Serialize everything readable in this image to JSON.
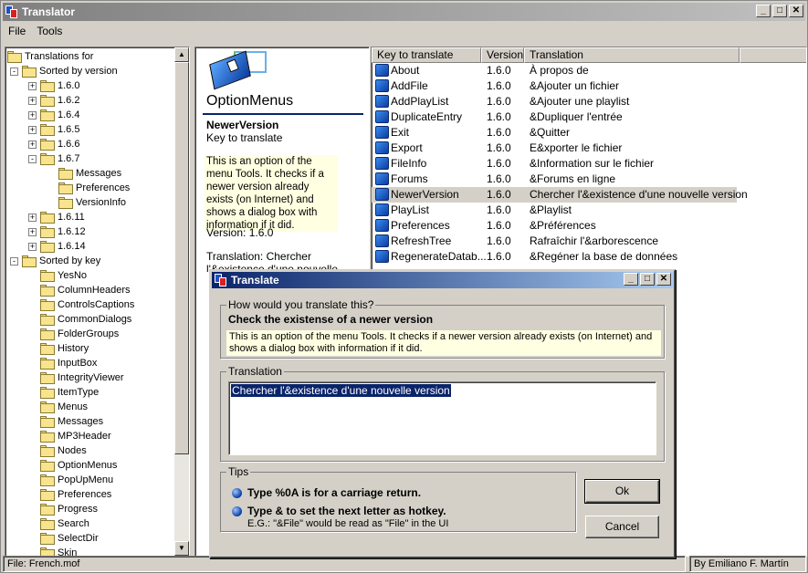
{
  "main_window": {
    "title": "Translator",
    "menu": [
      "File",
      "Tools"
    ]
  },
  "tree": {
    "root": "Translations for",
    "sorted_by_version": "Sorted by version",
    "versions": [
      "1.6.0",
      "1.6.2",
      "1.6.4",
      "1.6.5",
      "1.6.6",
      "1.6.7"
    ],
    "v167_children": [
      "Messages",
      "Preferences",
      "VersionInfo"
    ],
    "versions_after": [
      "1.6.11",
      "1.6.12",
      "1.6.14"
    ],
    "sorted_by_key": "Sorted by key",
    "keys": [
      "YesNo",
      "ColumnHeaders",
      "ControlsCaptions",
      "CommonDialogs",
      "FolderGroups",
      "History",
      "InputBox",
      "IntegrityViewer",
      "ItemType",
      "Menus",
      "Messages",
      "MP3Header",
      "Nodes",
      "OptionMenus",
      "PopUpMenu",
      "Preferences",
      "Progress",
      "Search",
      "SelectDir",
      "Skin"
    ]
  },
  "detail": {
    "section_title": "OptionMenus",
    "key": "NewerVersion",
    "key_caption": "Key to translate",
    "description": "This is an option of the menu Tools. It checks if a newer version already exists (on Internet) and shows a dialog box with information if it did.",
    "version_line": "Version: 1.6.0",
    "translation_line": "Translation: Chercher l'&existence d'une nouvelle version"
  },
  "list": {
    "headers": [
      "Key to translate",
      "Version",
      "Translation"
    ],
    "rows": [
      {
        "key": "About",
        "version": "1.6.0",
        "translation": "À propos de"
      },
      {
        "key": "AddFile",
        "version": "1.6.0",
        "translation": "&Ajouter un fichier"
      },
      {
        "key": "AddPlayList",
        "version": "1.6.0",
        "translation": "&Ajouter une playlist"
      },
      {
        "key": "DuplicateEntry",
        "version": "1.6.0",
        "translation": "&Dupliquer l'entrée"
      },
      {
        "key": "Exit",
        "version": "1.6.0",
        "translation": "&Quitter"
      },
      {
        "key": "Export",
        "version": "1.6.0",
        "translation": "E&xporter le fichier"
      },
      {
        "key": "FileInfo",
        "version": "1.6.0",
        "translation": "&Information sur le fichier"
      },
      {
        "key": "Forums",
        "version": "1.6.0",
        "translation": "&Forums en ligne"
      },
      {
        "key": "NewerVersion",
        "version": "1.6.0",
        "translation": "Chercher l'&existence d'une nouvelle version"
      },
      {
        "key": "PlayList",
        "version": "1.6.0",
        "translation": "&Playlist"
      },
      {
        "key": "Preferences",
        "version": "1.6.0",
        "translation": "&Préférences"
      },
      {
        "key": "RefreshTree",
        "version": "1.6.0",
        "translation": "Rafraîchir l'&arborescence"
      },
      {
        "key": "RegenerateDatab...",
        "version": "1.6.0",
        "translation": "&Regéner la base de données"
      }
    ],
    "selected_index": 8
  },
  "status": {
    "file": "File: French.mof",
    "author": "By Emiliano F. Martín"
  },
  "dialog": {
    "title": "Translate",
    "question_label": "How would you translate this?",
    "source": "Check the existense of a newer version",
    "description": "This is an option of the menu Tools. It checks if a newer version already exists (on Internet) and shows a dialog box with information if it did.",
    "translation_label": "Translation",
    "translation_value": "Chercher l'&existence d'une nouvelle version",
    "tips_label": "Tips",
    "tip1": "Type %0A is for a carriage return.",
    "tip2": "Type & to set the next letter as hotkey.",
    "tip2_example": "E.G.: \"&File\" would be read as \"File\" in the UI",
    "ok_label": "Ok",
    "cancel_label": "Cancel"
  }
}
